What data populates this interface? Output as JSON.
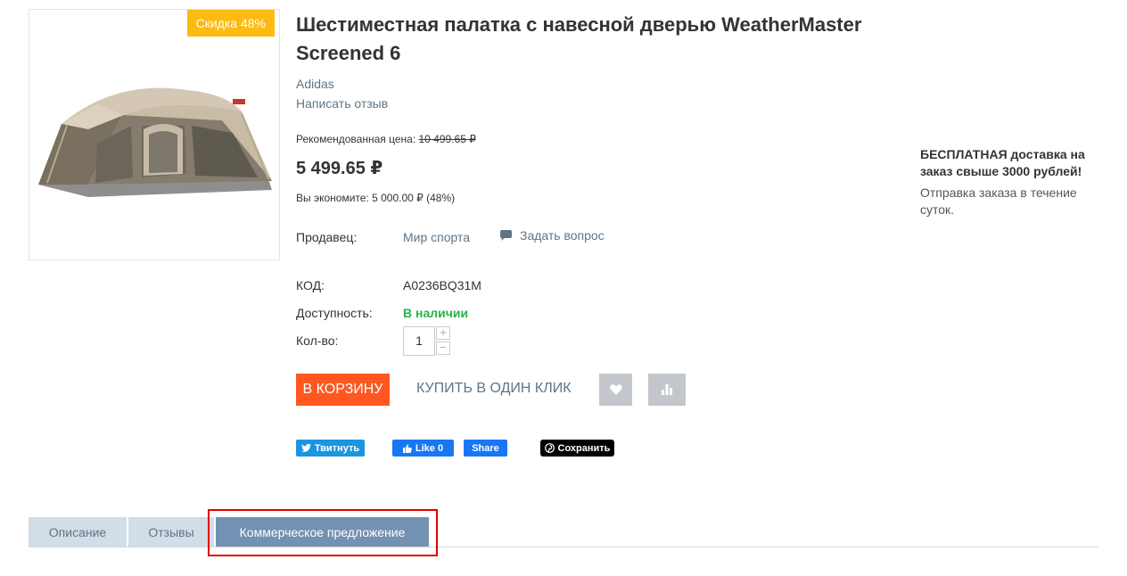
{
  "product": {
    "discount_badge": "Скидка 48%",
    "title_line1": "Шестиместная палатка с навесной дверью WeatherMaster",
    "title_line2": "Screened 6",
    "brand": "Adidas",
    "write_review": "Написать отзыв",
    "recommended_label": "Рекомендованная цена:",
    "recommended_price": "10 499.65 ₽",
    "price": "5 499.65 ₽",
    "savings": "Вы экономите: 5 000.00 ₽ (48%)",
    "seller_label": "Продавец:",
    "seller_value": "Мир спорта",
    "ask_question": "Задать вопрос",
    "code_label": "КОД:",
    "code_value": "A0236BQ31M",
    "availability_label": "Доступность:",
    "availability_value": "В наличии",
    "qty_label": "Кол-во:",
    "qty_value": "1",
    "qty_plus": "+",
    "qty_minus": "−"
  },
  "actions": {
    "add_to_cart": "В КОРЗИНУ",
    "buy_one_click": "КУПИТЬ В ОДИН КЛИК"
  },
  "social": {
    "tweet": "Твитнуть",
    "like": "Like 0",
    "share": "Share",
    "save": "Сохранить"
  },
  "delivery": {
    "title": "БЕСПЛАТНАЯ доставка на заказ свыше 3000 рублей!",
    "text": "Отправка заказа в течение суток."
  },
  "tabs": {
    "description": "Описание",
    "reviews": "Отзывы",
    "offer": "Коммерческое предложение"
  },
  "colors": {
    "cart_button": "#ff5722",
    "in_stock": "#28b447",
    "badge": "#fdba12",
    "active_tab": "#7391b2",
    "highlight": "#e30000"
  }
}
